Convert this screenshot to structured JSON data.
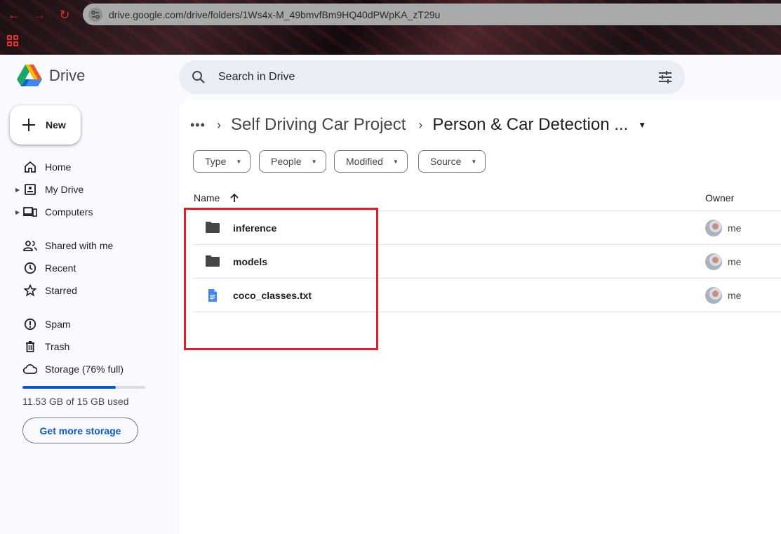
{
  "browser": {
    "url": "drive.google.com/drive/folders/1Ws4x-M_49bmvfBm9HQ40dPWpKA_zT29u",
    "accent_color": "#e0322f"
  },
  "app": {
    "name": "Drive",
    "search_placeholder": "Search in Drive"
  },
  "sidebar": {
    "new_label": "New",
    "items": [
      {
        "label": "Home",
        "icon": "home-icon"
      },
      {
        "label": "My Drive",
        "icon": "my-drive-icon"
      },
      {
        "label": "Computers",
        "icon": "computers-icon"
      },
      {
        "label": "Shared with me",
        "icon": "shared-icon"
      },
      {
        "label": "Recent",
        "icon": "clock-icon"
      },
      {
        "label": "Starred",
        "icon": "star-icon"
      },
      {
        "label": "Spam",
        "icon": "spam-icon"
      },
      {
        "label": "Trash",
        "icon": "trash-icon"
      },
      {
        "label": "Storage (76% full)",
        "icon": "cloud-icon"
      }
    ],
    "storage": {
      "used_fraction": 0.76,
      "used_text": "11.53 GB of 15 GB used",
      "cta": "Get more storage"
    }
  },
  "breadcrumb": {
    "parent": "Self Driving Car Project",
    "current": "Person & Car Detection ..."
  },
  "filters": [
    "Type",
    "People",
    "Modified",
    "Source"
  ],
  "table": {
    "columns": {
      "name": "Name",
      "owner": "Owner"
    },
    "rows": [
      {
        "name": "inference",
        "type": "folder",
        "owner": "me"
      },
      {
        "name": "models",
        "type": "folder",
        "owner": "me"
      },
      {
        "name": "coco_classes.txt",
        "type": "document",
        "owner": "me"
      }
    ]
  },
  "colors": {
    "highlight": "#e11d25",
    "link": "#0b57d0",
    "doc_icon": "#4285f4"
  }
}
